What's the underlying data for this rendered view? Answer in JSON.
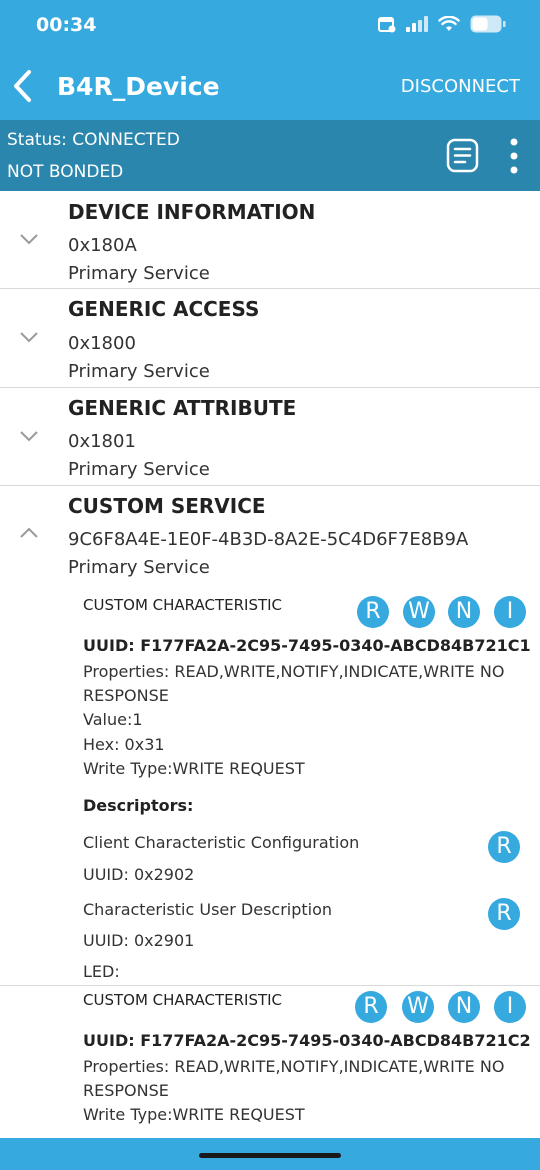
{
  "status_bar": {
    "time": "00:34"
  },
  "app_bar": {
    "title": "B4R_Device",
    "disconnect_label": "DISCONNECT"
  },
  "connection": {
    "status": "Status: CONNECTED",
    "bond": "NOT BONDED"
  },
  "services": [
    {
      "name": "DEVICE INFORMATION",
      "uuid": "0x180A",
      "type": "Primary Service",
      "expanded": false
    },
    {
      "name": "GENERIC ACCESS",
      "uuid": "0x1800",
      "type": "Primary Service",
      "expanded": false
    },
    {
      "name": "GENERIC ATTRIBUTE",
      "uuid": "0x1801",
      "type": "Primary Service",
      "expanded": false
    },
    {
      "name": "CUSTOM SERVICE",
      "uuid": "9C6F8A4E-1E0F-4B3D-8A2E-5C4D6F7E8B9A",
      "type": "Primary Service",
      "expanded": true
    }
  ],
  "characteristics": [
    {
      "name": "CUSTOM CHARACTERISTIC",
      "uuid": "UUID: F177FA2A-2C95-7495-0340-ABCD84B721C1",
      "properties_line1": "Properties: READ,WRITE,NOTIFY,INDICATE,WRITE NO",
      "properties_line2": "RESPONSE",
      "value": "Value:1",
      "hex": "Hex: 0x31",
      "write_type": "Write Type:WRITE REQUEST",
      "badges": [
        "R",
        "W",
        "N",
        "I"
      ],
      "descriptors_label": "Descriptors:",
      "descriptors": [
        {
          "name": "Client Characteristic Configuration",
          "uuid": "UUID: 0x2902",
          "badge": "R"
        },
        {
          "name": "Characteristic User Description",
          "uuid": "UUID: 0x2901",
          "badge": "R",
          "value": "LED:"
        }
      ]
    },
    {
      "name": "CUSTOM CHARACTERISTIC",
      "uuid": "UUID: F177FA2A-2C95-7495-0340-ABCD84B721C2",
      "properties_line1": "Properties: READ,WRITE,NOTIFY,INDICATE,WRITE NO",
      "properties_line2": "RESPONSE",
      "write_type": "Write Type:WRITE REQUEST",
      "badges": [
        "R",
        "W",
        "N",
        "I"
      ]
    }
  ],
  "colors": {
    "primary": "#36a9df",
    "connection_bar": "#2a86ad"
  }
}
